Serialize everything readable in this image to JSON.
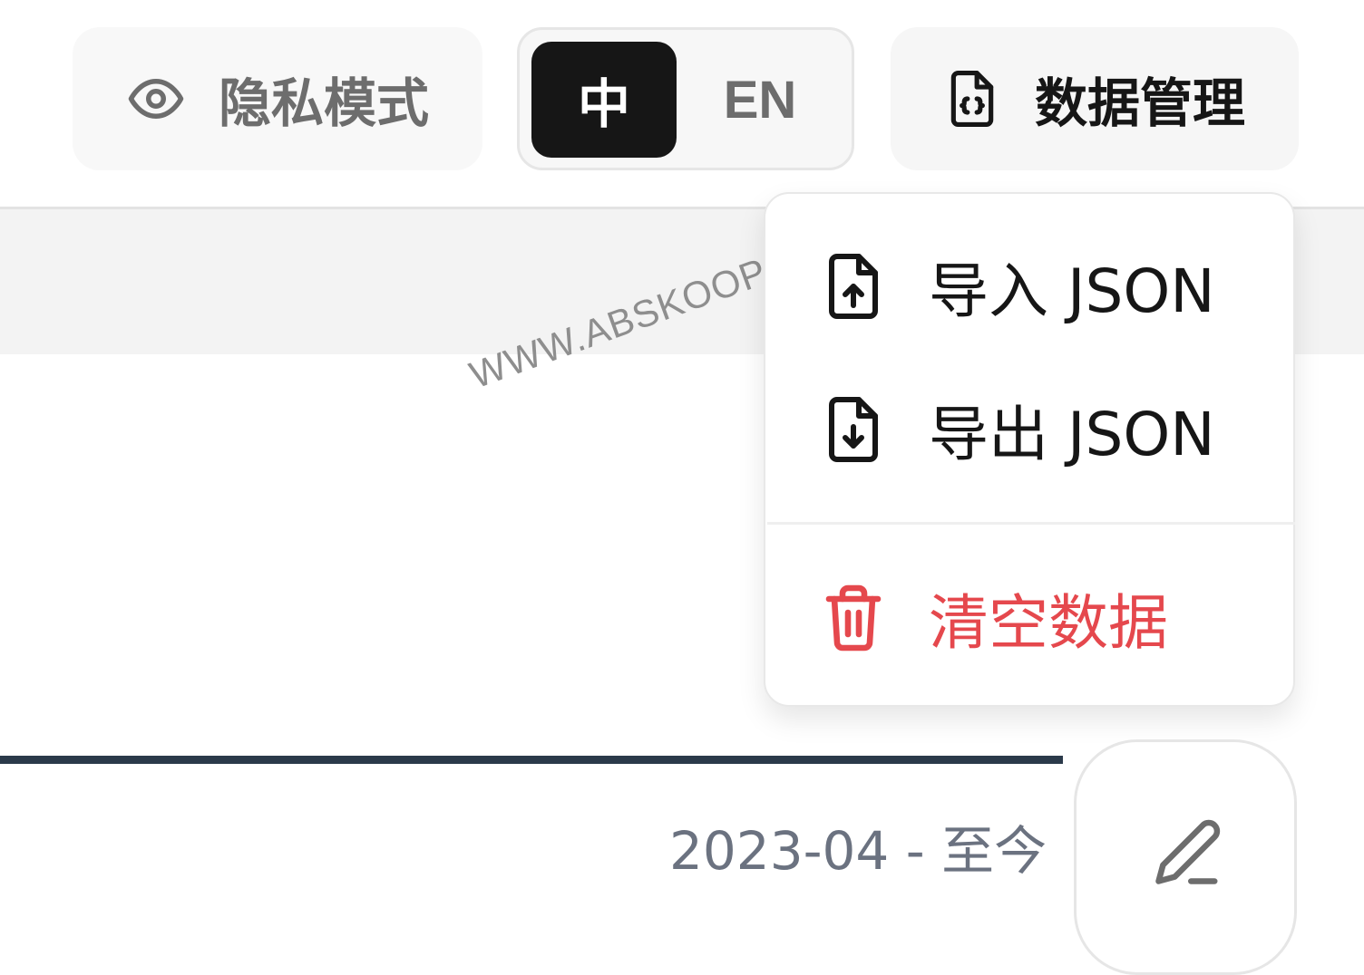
{
  "toolbar": {
    "privacy": {
      "label": "隐私模式",
      "icon": "eye-icon"
    },
    "language": {
      "options": [
        "中",
        "EN"
      ],
      "selected": "中",
      "active_bg": "#161616"
    },
    "data_management": {
      "label": "数据管理",
      "icon": "file-code-icon"
    }
  },
  "dropdown": {
    "items": [
      {
        "label": "导入 JSON",
        "icon": "file-upload-icon",
        "color": "#161616"
      },
      {
        "label": "导出 JSON",
        "icon": "file-download-icon",
        "color": "#161616"
      },
      {
        "label": "清空数据",
        "icon": "trash-icon",
        "color": "#e5484d"
      }
    ]
  },
  "entry": {
    "date_range": "2023-04 - 至今",
    "edit_icon": "pencil-icon"
  },
  "watermark": "WWW.ABSKOOP.COM",
  "colors": {
    "danger": "#e5484d",
    "progress": "#2b3a4a",
    "muted_text": "#6b7280"
  }
}
